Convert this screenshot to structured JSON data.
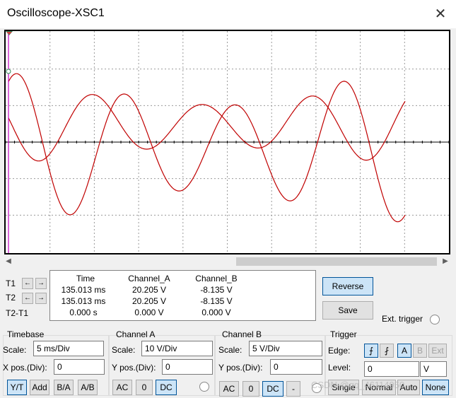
{
  "window": {
    "title": "Oscilloscope-XSC1",
    "close_glyph": "✕"
  },
  "colors": {
    "trace_a": "#c00000",
    "grid": "#9a9a9a",
    "screen_bg": "#ffffff",
    "cursor": "#c000c0",
    "axis": "#000000"
  },
  "cursors": {
    "t1_label": "T1",
    "t2_label": "T2",
    "diff_label": "T2-T1",
    "left_arrow": "←",
    "right_arrow": "→"
  },
  "readout": {
    "headers": [
      "Time",
      "Channel_A",
      "Channel_B"
    ],
    "rows": [
      [
        "135.013 ms",
        "20.205 V",
        "-8.135 V"
      ],
      [
        "135.013 ms",
        "20.205 V",
        "-8.135 V"
      ],
      [
        "0.000 s",
        "0.000 V",
        "0.000 V"
      ]
    ]
  },
  "actions": {
    "reverse": "Reverse",
    "save": "Save",
    "ext_trigger": "Ext. trigger"
  },
  "timebase": {
    "title": "Timebase",
    "scale_label": "Scale:",
    "scale_value": "5 ms/Div",
    "xpos_label": "X pos.(Div):",
    "xpos_value": "0",
    "modes": [
      "Y/T",
      "Add",
      "B/A",
      "A/B"
    ]
  },
  "channel_a": {
    "title": "Channel A",
    "scale_label": "Scale:",
    "scale_value": "10  V/Div",
    "ypos_label": "Y pos.(Div):",
    "ypos_value": "0",
    "coupling": [
      "AC",
      "0",
      "DC"
    ]
  },
  "channel_b": {
    "title": "Channel B",
    "scale_label": "Scale:",
    "scale_value": "5  V/Div",
    "ypos_label": "Y pos.(Div):",
    "ypos_value": "0",
    "coupling": [
      "AC",
      "0",
      "DC",
      "-"
    ]
  },
  "trigger": {
    "title": "Trigger",
    "edge_label": "Edge:",
    "edge_rise": "⨍",
    "edge_fall": "⨏",
    "sources": [
      "A",
      "B",
      "Ext"
    ],
    "level_label": "Level:",
    "level_value": "0",
    "level_unit": "V",
    "modes": [
      "Single",
      "Normal",
      "Auto",
      "None"
    ]
  },
  "watermark": "CSDN @qq_46114950"
}
